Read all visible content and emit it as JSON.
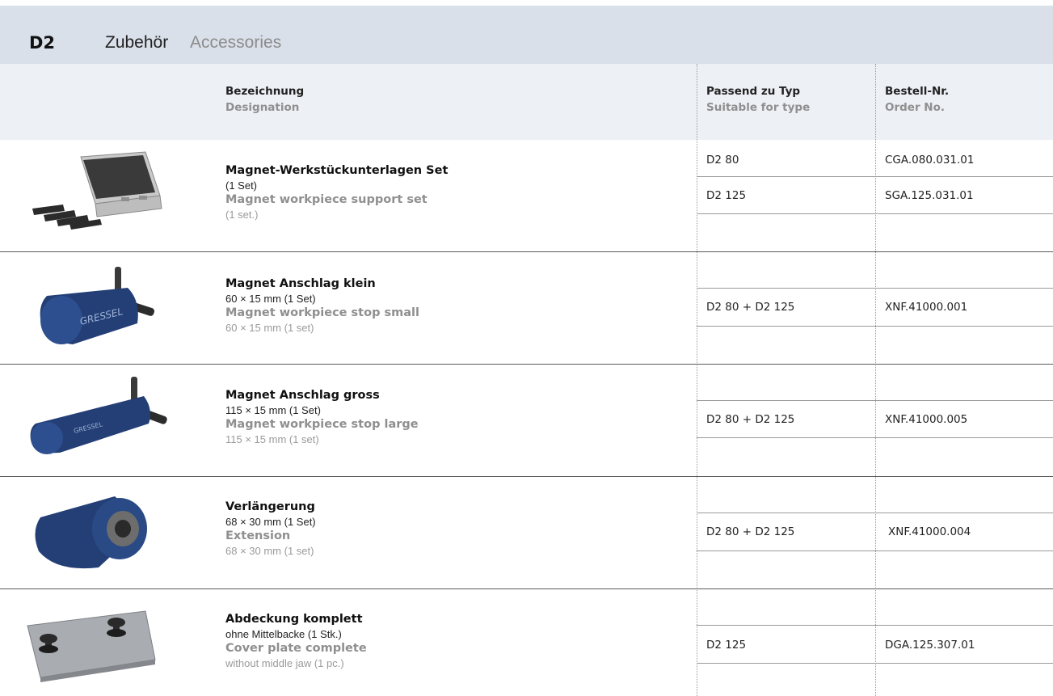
{
  "header": {
    "code": "D2",
    "title_de": "Zubehör",
    "title_en": "Accessories"
  },
  "columns": {
    "designation_de": "Bezeichnung",
    "designation_en": "Designation",
    "type_de": "Passend zu Typ",
    "type_en": "Suitable for type",
    "order_de": "Bestell-Nr.",
    "order_en": "Order No."
  },
  "items": [
    {
      "name_de": "Magnet-Werkstückunterlagen Set",
      "sub_de": "(1 Set)",
      "name_en": "Magnet workpiece support set",
      "sub_en": "(1 set.)",
      "picture": "workpiece-support-set-case",
      "rows": [
        {
          "type": "D2 80",
          "order": "CGA.080.031.01"
        },
        {
          "type": "D2 125",
          "order": "SGA.125.031.01"
        }
      ]
    },
    {
      "name_de": "Magnet Anschlag klein",
      "sub_de": "60 × 15 mm (1 Set)",
      "name_en": "Magnet workpiece stop small",
      "sub_en": "60 × 15 mm (1 set)",
      "picture": "magnet-stop-small",
      "logo_text": "GRESSEL",
      "rows": [
        {
          "type": "D2 80 + D2 125",
          "order": "XNF.41000.001"
        }
      ]
    },
    {
      "name_de": "Magnet Anschlag gross",
      "sub_de": "115 × 15 mm (1 Set)",
      "name_en": "Magnet workpiece stop large",
      "sub_en": "115 × 15 mm (1 set)",
      "picture": "magnet-stop-large",
      "logo_text": "GRESSEL",
      "rows": [
        {
          "type": "D2 80 + D2 125",
          "order": "XNF.41000.005"
        }
      ]
    },
    {
      "name_de": "Verlängerung",
      "sub_de": "68 × 30 mm (1 Set)",
      "name_en": "Extension",
      "sub_en": "68 × 30 mm (1 set)",
      "picture": "extension",
      "rows": [
        {
          "type": "D2 80 + D2 125",
          "order": "XNF.41000.004"
        }
      ]
    },
    {
      "name_de": "Abdeckung komplett",
      "sub_de": "ohne Mittelbacke (1 Stk.)",
      "name_en": "Cover plate complete",
      "sub_en": "without middle jaw (1 pc.)",
      "picture": "cover-plate",
      "rows": [
        {
          "type": "D2 125",
          "order": "DGA.125.307.01"
        }
      ]
    }
  ],
  "colors": {
    "header_band": "#d9e0ea",
    "column_band": "#edf0f5",
    "magnet_blue": "#233f76"
  }
}
